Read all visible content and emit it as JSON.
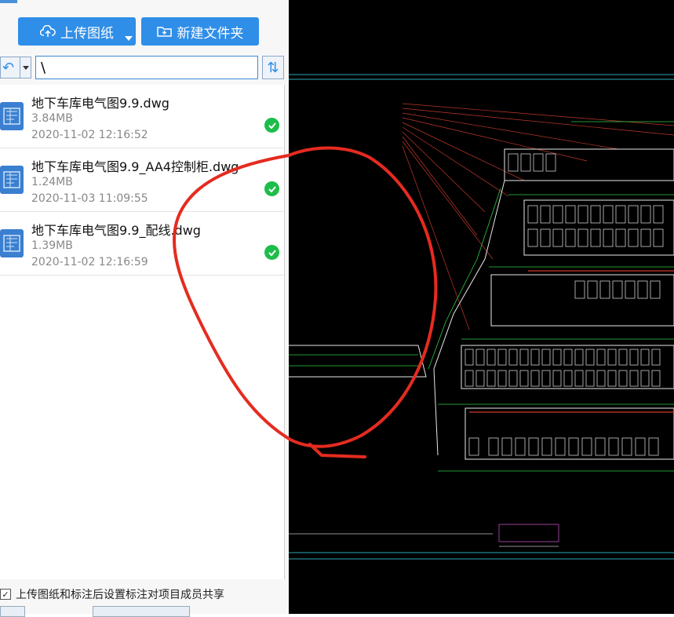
{
  "toolbar": {
    "upload_label": "上传图纸",
    "new_folder_label": "新建文件夹"
  },
  "path": {
    "value": "\\"
  },
  "files": [
    {
      "name": "地下车库电气图9.9.dwg",
      "size": "3.84MB",
      "date": "2020-11-02 12:16:52"
    },
    {
      "name": "地下车库电气图9.9_AA4控制柜.dwg",
      "size": "1.24MB",
      "date": "2020-11-03 11:09:55"
    },
    {
      "name": "地下车库电气图9.9_配线.dwg",
      "size": "1.39MB",
      "date": "2020-11-02 12:16:59"
    }
  ],
  "footer": {
    "share_label": "上传图纸和标注后设置标注对项目成员共享",
    "share_checked": true
  },
  "colors": {
    "accent": "#2f8ee8",
    "status_ok": "#1dbd4a",
    "cad_background": "#000000",
    "annotation": "#e52b20"
  },
  "icons": [
    "upload-cloud-icon",
    "new-folder-icon",
    "back-arrow-icon",
    "refresh-icon",
    "dwg-file-icon",
    "check-circle-icon"
  ]
}
